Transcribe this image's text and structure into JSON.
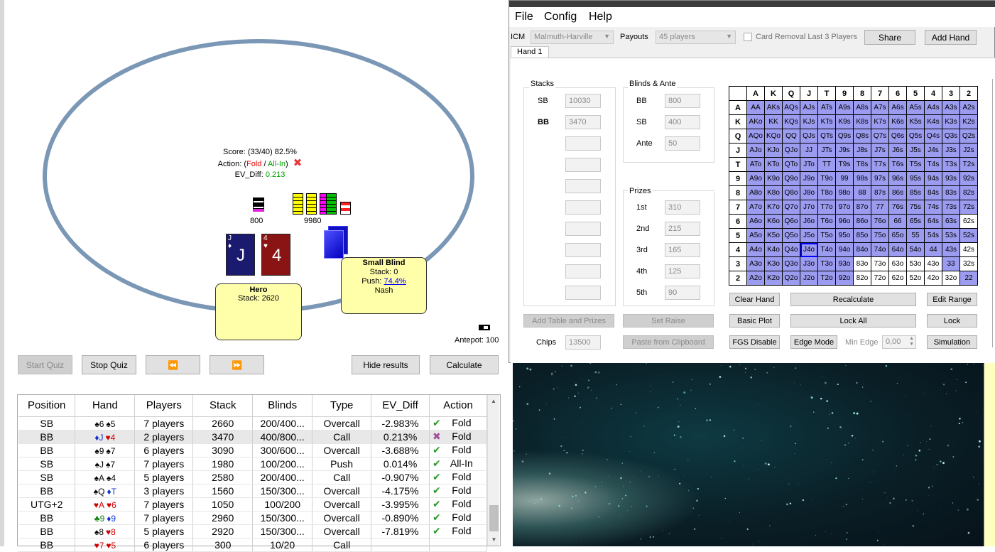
{
  "table_view": {
    "score": "Score: (33/40) 82.5%",
    "action_prefix": "Action: (",
    "action_fold": "Fold",
    "action_sep": " / ",
    "action_allin": "All-In",
    "action_suffix": ")",
    "ev_label": "EV_Diff: ",
    "ev_value": "0.213",
    "bb_chips": "800",
    "pot_chips": "9980",
    "hero_card1": {
      "rank": "J",
      "suit": "♦",
      "big": "J"
    },
    "hero_card2": {
      "rank": "4",
      "suit": "♥",
      "big": "4"
    },
    "hero_title": "Hero",
    "hero_stack": "Stack: 2620",
    "sb_title": "Small Blind",
    "sb_stack": "Stack: 0",
    "sb_push_label": "Push: ",
    "sb_push_value": "74.4%",
    "sb_mode": "Nash",
    "antepot": "Antepot: 100",
    "colors": {
      "table_ring": "#7b97b6",
      "seat_box": "#ffffaa",
      "fold": "#e00000",
      "allin": "#00a000"
    }
  },
  "controls": {
    "start_quiz": "Start Quiz",
    "stop_quiz": "Stop Quiz",
    "prev": "⏪",
    "next": "⏩",
    "hide_results": "Hide results",
    "calculate": "Calculate"
  },
  "history": {
    "headers": [
      "Position",
      "Hand",
      "Players",
      "Stack",
      "Blinds",
      "Type",
      "EV_Diff",
      "Action"
    ],
    "rows": [
      {
        "pos": "SB",
        "c1": "♠6",
        "c2": "♠5",
        "c1c": "#000",
        "c2c": "#000",
        "players": "7 players",
        "stack": "2660",
        "blinds": "200/400...",
        "type": "Overcall",
        "ev": "-2.983%",
        "mark": "✔",
        "action": "Fold"
      },
      {
        "pos": "BB",
        "c1": "♦J",
        "c2": "♥4",
        "c1c": "#1030d0",
        "c2c": "#d00000",
        "players": "2 players",
        "stack": "3470",
        "blinds": "400/800...",
        "type": "Call",
        "ev": "0.213%",
        "mark": "✖",
        "action": "Fold"
      },
      {
        "pos": "BB",
        "c1": "♠9",
        "c2": "♠7",
        "c1c": "#000",
        "c2c": "#000",
        "players": "6 players",
        "stack": "3090",
        "blinds": "300/600...",
        "type": "Overcall",
        "ev": "-3.688%",
        "mark": "✔",
        "action": "Fold"
      },
      {
        "pos": "SB",
        "c1": "♠J",
        "c2": "♠7",
        "c1c": "#000",
        "c2c": "#000",
        "players": "7 players",
        "stack": "1980",
        "blinds": "100/200...",
        "type": "Push",
        "ev": "0.014%",
        "mark": "✔",
        "action": "All-In"
      },
      {
        "pos": "SB",
        "c1": "♠A",
        "c2": "♠4",
        "c1c": "#000",
        "c2c": "#000",
        "players": "5 players",
        "stack": "2580",
        "blinds": "200/400...",
        "type": "Call",
        "ev": "-0.907%",
        "mark": "✔",
        "action": "Fold"
      },
      {
        "pos": "BB",
        "c1": "♠Q",
        "c2": "♦T",
        "c1c": "#000",
        "c2c": "#1030d0",
        "players": "3 players",
        "stack": "1560",
        "blinds": "150/300...",
        "type": "Overcall",
        "ev": "-4.175%",
        "mark": "✔",
        "action": "Fold"
      },
      {
        "pos": "UTG+2",
        "c1": "♥A",
        "c2": "♥6",
        "c1c": "#d00000",
        "c2c": "#d00000",
        "players": "7 players",
        "stack": "1050",
        "blinds": "100/200",
        "type": "Overcall",
        "ev": "-3.995%",
        "mark": "✔",
        "action": "Fold"
      },
      {
        "pos": "BB",
        "c1": "♣9",
        "c2": "♦9",
        "c1c": "#108010",
        "c2c": "#1030d0",
        "players": "7 players",
        "stack": "2960",
        "blinds": "150/300...",
        "type": "Overcall",
        "ev": "-0.890%",
        "mark": "✔",
        "action": "Fold"
      },
      {
        "pos": "BB",
        "c1": "♠8",
        "c2": "♥8",
        "c1c": "#000",
        "c2c": "#d00000",
        "players": "5 players",
        "stack": "2920",
        "blinds": "150/300...",
        "type": "Overcall",
        "ev": "-7.819%",
        "mark": "✔",
        "action": "Fold"
      },
      {
        "pos": "BB",
        "c1": "♥7",
        "c2": "♥5",
        "c1c": "#d00000",
        "c2c": "#d00000",
        "players": "6 players",
        "stack": "300",
        "blinds": "10/20",
        "type": "Call",
        "ev": "",
        "mark": "",
        "action": ""
      }
    ]
  },
  "calc": {
    "menu": [
      "File",
      "Config",
      "Help"
    ],
    "icm_label": "ICM",
    "icm_value": "Malmuth-Harville",
    "payouts_label": "Payouts",
    "payouts_value": "45 players",
    "card_removal": "Card Removal Last 3 Players",
    "share": "Share",
    "add_hand": "Add Hand",
    "tab": "Hand 1",
    "stacks_title": "Stacks",
    "sb_label": "SB",
    "sb_value": "10030",
    "bb_label": "BB",
    "bb_value": "3470",
    "blinds_title": "Blinds & Ante",
    "blind_bb_label": "BB",
    "blind_bb_value": "800",
    "blind_sb_label": "SB",
    "blind_sb_value": "400",
    "ante_label": "Ante",
    "ante_value": "50",
    "prizes_title": "Prizes",
    "prizes": [
      {
        "label": "1st",
        "value": "310"
      },
      {
        "label": "2nd",
        "value": "215"
      },
      {
        "label": "3rd",
        "value": "165"
      },
      {
        "label": "4th",
        "value": "125"
      },
      {
        "label": "5th",
        "value": "90"
      }
    ],
    "add_table": "Add Table and Prizes",
    "set_raise": "Set Raise",
    "chips_label": "Chips",
    "chips_value": "13500",
    "paste": "Paste from Clipboard",
    "clear_hand": "Clear Hand",
    "recalculate": "Recalculate",
    "edit_range": "Edit Range",
    "basic_plot": "Basic Plot",
    "lock_all": "Lock All",
    "lock": "Lock",
    "fgs_disable": "FGS Disable",
    "edge_mode": "Edge Mode",
    "min_edge_label": "Min Edge",
    "min_edge_value": "0,00",
    "simulation": "Simulation",
    "range_headers": [
      "A",
      "K",
      "Q",
      "J",
      "T",
      "9",
      "8",
      "7",
      "6",
      "5",
      "4",
      "3",
      "2"
    ],
    "range_rows": [
      [
        "AA",
        "AKs",
        "AQs",
        "AJs",
        "ATs",
        "A9s",
        "A8s",
        "A7s",
        "A6s",
        "A5s",
        "A4s",
        "A3s",
        "A2s"
      ],
      [
        "AKo",
        "KK",
        "KQs",
        "KJs",
        "KTs",
        "K9s",
        "K8s",
        "K7s",
        "K6s",
        "K5s",
        "K4s",
        "K3s",
        "K2s"
      ],
      [
        "AQo",
        "KQo",
        "QQ",
        "QJs",
        "QTs",
        "Q9s",
        "Q8s",
        "Q7s",
        "Q6s",
        "Q5s",
        "Q4s",
        "Q3s",
        "Q2s"
      ],
      [
        "AJo",
        "KJo",
        "QJo",
        "JJ",
        "JTs",
        "J9s",
        "J8s",
        "J7s",
        "J6s",
        "J5s",
        "J4s",
        "J3s",
        "J2s"
      ],
      [
        "ATo",
        "KTo",
        "QTo",
        "JTo",
        "TT",
        "T9s",
        "T8s",
        "T7s",
        "T6s",
        "T5s",
        "T4s",
        "T3s",
        "T2s"
      ],
      [
        "A9o",
        "K9o",
        "Q9o",
        "J9o",
        "T9o",
        "99",
        "98s",
        "97s",
        "96s",
        "95s",
        "94s",
        "93s",
        "92s"
      ],
      [
        "A8o",
        "K8o",
        "Q8o",
        "J8o",
        "T8o",
        "98o",
        "88",
        "87s",
        "86s",
        "85s",
        "84s",
        "83s",
        "82s"
      ],
      [
        "A7o",
        "K7o",
        "Q7o",
        "J7o",
        "T7o",
        "97o",
        "87o",
        "77",
        "76s",
        "75s",
        "74s",
        "73s",
        "72s"
      ],
      [
        "A6o",
        "K6o",
        "Q6o",
        "J6o",
        "T6o",
        "96o",
        "86o",
        "76o",
        "66",
        "65s",
        "64s",
        "63s",
        "62s"
      ],
      [
        "A5o",
        "K5o",
        "Q5o",
        "J5o",
        "T5o",
        "95o",
        "85o",
        "75o",
        "65o",
        "55",
        "54s",
        "53s",
        "52s"
      ],
      [
        "A4o",
        "K4o",
        "Q4o",
        "J4o",
        "T4o",
        "94o",
        "84o",
        "74o",
        "64o",
        "54o",
        "44",
        "43s",
        "42s"
      ],
      [
        "A3o",
        "K3o",
        "Q3o",
        "J3o",
        "T3o",
        "93o",
        "83o",
        "73o",
        "63o",
        "53o",
        "43o",
        "33",
        "32s"
      ],
      [
        "A2o",
        "K2o",
        "Q2o",
        "J2o",
        "T2o",
        "92o",
        "82o",
        "72o",
        "62o",
        "52o",
        "42o",
        "32o",
        "22"
      ]
    ],
    "range_off": [
      "62s",
      "42s",
      "32s",
      "83o",
      "73o",
      "63o",
      "53o",
      "43o",
      "82o",
      "72o",
      "62o",
      "52o",
      "42o",
      "32o"
    ],
    "selected_hand": "J4o",
    "colors": {
      "in_range": "#9b9bf0",
      "selected": "#0000ff"
    }
  }
}
